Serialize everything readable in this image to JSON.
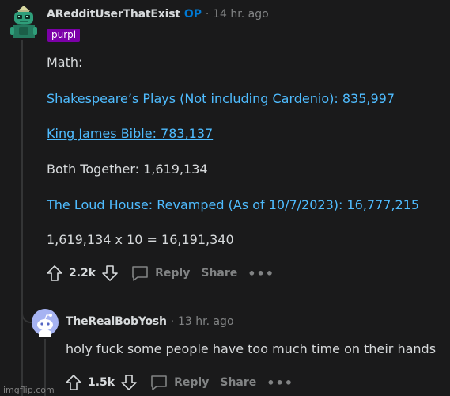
{
  "op_comment": {
    "username": "ARedditUserThatExist",
    "op_badge": "OP",
    "timestamp": "14 hr. ago",
    "flair": "purpl",
    "avatar_icon": "snoo-gecko-avatar-icon",
    "lines": [
      "Math:",
      "Shakespeare’s Plays (Not including Cardenio): 835,997",
      "King James Bible: 783,137",
      "Both Together: 1,619,134",
      "The Loud House: Revamped (As of 10/7/2023): 16,777,215",
      "1,619,134 x 10 = 16,191,340"
    ],
    "votes": "2.2k",
    "reply_label": "Reply",
    "share_label": "Share",
    "more_label": "•••"
  },
  "reply_comment": {
    "username": "TheRealBobYosh",
    "timestamp": "13 hr. ago",
    "avatar_icon": "default-snoo-avatar-icon",
    "text": "holy fuck some people have too much time on their hands",
    "votes": "1.5k",
    "reply_label": "Reply",
    "share_label": "Share",
    "more_label": "•••"
  },
  "separator": "·",
  "watermark": "imgflip.com",
  "colors": {
    "background": "#1a1a1b",
    "text": "#d7dadc",
    "muted": "#818384",
    "link": "#4fbcff",
    "op_blue": "#0079d3",
    "flair_purple": "#7c00a8"
  }
}
